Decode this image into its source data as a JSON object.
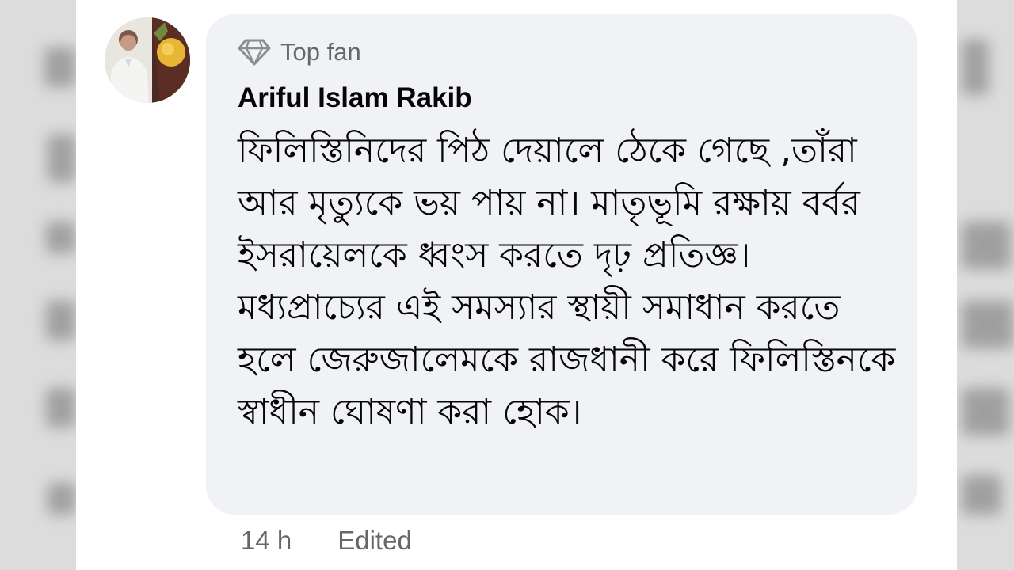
{
  "comment": {
    "badge": {
      "icon": "diamond-icon",
      "label": "Top fan"
    },
    "author_name": "Ariful Islam Rakib",
    "text": "ফিলিস্তিনিদের পিঠ দেয়ালে ঠেকে গেছে ,তাঁরা আর মৃত্যুকে ভয় পায় না। মাতৃভূমি রক্ষায় বর্বর ইসরায়েলকে ধ্বংস করতে দৃঢ় প্রতিজ্ঞ। মধ্যপ্রাচ্যের এই সমস্যার স্থায়ী সমাধান করতে হলে জেরুজালেমকে রাজধানী করে ফিলিস্তিনকে স্বাধীন ঘোষণা করা হোক।",
    "timestamp": "14 h",
    "edited_label": "Edited"
  },
  "colors": {
    "bubble_background": "#f0f2f5",
    "primary_text": "#050505",
    "secondary_text": "#65676b",
    "badge_icon": "#8a8d91"
  }
}
